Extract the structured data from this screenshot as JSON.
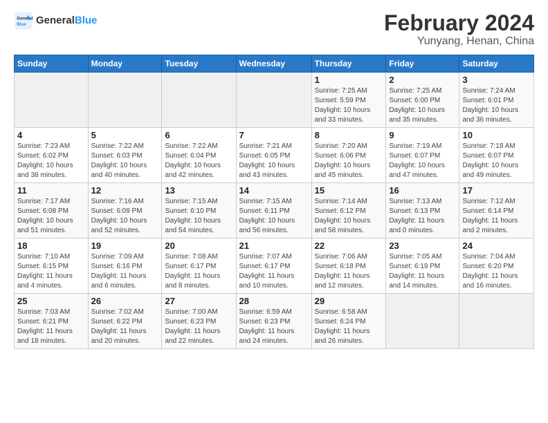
{
  "logo": {
    "line1": "General",
    "line2": "Blue"
  },
  "title": "February 2024",
  "subtitle": "Yunyang, Henan, China",
  "days_of_week": [
    "Sunday",
    "Monday",
    "Tuesday",
    "Wednesday",
    "Thursday",
    "Friday",
    "Saturday"
  ],
  "weeks": [
    [
      {
        "day": "",
        "info": ""
      },
      {
        "day": "",
        "info": ""
      },
      {
        "day": "",
        "info": ""
      },
      {
        "day": "",
        "info": ""
      },
      {
        "day": "1",
        "info": "Sunrise: 7:25 AM\nSunset: 5:59 PM\nDaylight: 10 hours\nand 33 minutes."
      },
      {
        "day": "2",
        "info": "Sunrise: 7:25 AM\nSunset: 6:00 PM\nDaylight: 10 hours\nand 35 minutes."
      },
      {
        "day": "3",
        "info": "Sunrise: 7:24 AM\nSunset: 6:01 PM\nDaylight: 10 hours\nand 36 minutes."
      }
    ],
    [
      {
        "day": "4",
        "info": "Sunrise: 7:23 AM\nSunset: 6:02 PM\nDaylight: 10 hours\nand 38 minutes."
      },
      {
        "day": "5",
        "info": "Sunrise: 7:22 AM\nSunset: 6:03 PM\nDaylight: 10 hours\nand 40 minutes."
      },
      {
        "day": "6",
        "info": "Sunrise: 7:22 AM\nSunset: 6:04 PM\nDaylight: 10 hours\nand 42 minutes."
      },
      {
        "day": "7",
        "info": "Sunrise: 7:21 AM\nSunset: 6:05 PM\nDaylight: 10 hours\nand 43 minutes."
      },
      {
        "day": "8",
        "info": "Sunrise: 7:20 AM\nSunset: 6:06 PM\nDaylight: 10 hours\nand 45 minutes."
      },
      {
        "day": "9",
        "info": "Sunrise: 7:19 AM\nSunset: 6:07 PM\nDaylight: 10 hours\nand 47 minutes."
      },
      {
        "day": "10",
        "info": "Sunrise: 7:18 AM\nSunset: 6:07 PM\nDaylight: 10 hours\nand 49 minutes."
      }
    ],
    [
      {
        "day": "11",
        "info": "Sunrise: 7:17 AM\nSunset: 6:08 PM\nDaylight: 10 hours\nand 51 minutes."
      },
      {
        "day": "12",
        "info": "Sunrise: 7:16 AM\nSunset: 6:09 PM\nDaylight: 10 hours\nand 52 minutes."
      },
      {
        "day": "13",
        "info": "Sunrise: 7:15 AM\nSunset: 6:10 PM\nDaylight: 10 hours\nand 54 minutes."
      },
      {
        "day": "14",
        "info": "Sunrise: 7:15 AM\nSunset: 6:11 PM\nDaylight: 10 hours\nand 56 minutes."
      },
      {
        "day": "15",
        "info": "Sunrise: 7:14 AM\nSunset: 6:12 PM\nDaylight: 10 hours\nand 58 minutes."
      },
      {
        "day": "16",
        "info": "Sunrise: 7:13 AM\nSunset: 6:13 PM\nDaylight: 11 hours\nand 0 minutes."
      },
      {
        "day": "17",
        "info": "Sunrise: 7:12 AM\nSunset: 6:14 PM\nDaylight: 11 hours\nand 2 minutes."
      }
    ],
    [
      {
        "day": "18",
        "info": "Sunrise: 7:10 AM\nSunset: 6:15 PM\nDaylight: 11 hours\nand 4 minutes."
      },
      {
        "day": "19",
        "info": "Sunrise: 7:09 AM\nSunset: 6:16 PM\nDaylight: 11 hours\nand 6 minutes."
      },
      {
        "day": "20",
        "info": "Sunrise: 7:08 AM\nSunset: 6:17 PM\nDaylight: 11 hours\nand 8 minutes."
      },
      {
        "day": "21",
        "info": "Sunrise: 7:07 AM\nSunset: 6:17 PM\nDaylight: 11 hours\nand 10 minutes."
      },
      {
        "day": "22",
        "info": "Sunrise: 7:06 AM\nSunset: 6:18 PM\nDaylight: 11 hours\nand 12 minutes."
      },
      {
        "day": "23",
        "info": "Sunrise: 7:05 AM\nSunset: 6:19 PM\nDaylight: 11 hours\nand 14 minutes."
      },
      {
        "day": "24",
        "info": "Sunrise: 7:04 AM\nSunset: 6:20 PM\nDaylight: 11 hours\nand 16 minutes."
      }
    ],
    [
      {
        "day": "25",
        "info": "Sunrise: 7:03 AM\nSunset: 6:21 PM\nDaylight: 11 hours\nand 18 minutes."
      },
      {
        "day": "26",
        "info": "Sunrise: 7:02 AM\nSunset: 6:22 PM\nDaylight: 11 hours\nand 20 minutes."
      },
      {
        "day": "27",
        "info": "Sunrise: 7:00 AM\nSunset: 6:23 PM\nDaylight: 11 hours\nand 22 minutes."
      },
      {
        "day": "28",
        "info": "Sunrise: 6:59 AM\nSunset: 6:23 PM\nDaylight: 11 hours\nand 24 minutes."
      },
      {
        "day": "29",
        "info": "Sunrise: 6:58 AM\nSunset: 6:24 PM\nDaylight: 11 hours\nand 26 minutes."
      },
      {
        "day": "",
        "info": ""
      },
      {
        "day": "",
        "info": ""
      }
    ]
  ]
}
